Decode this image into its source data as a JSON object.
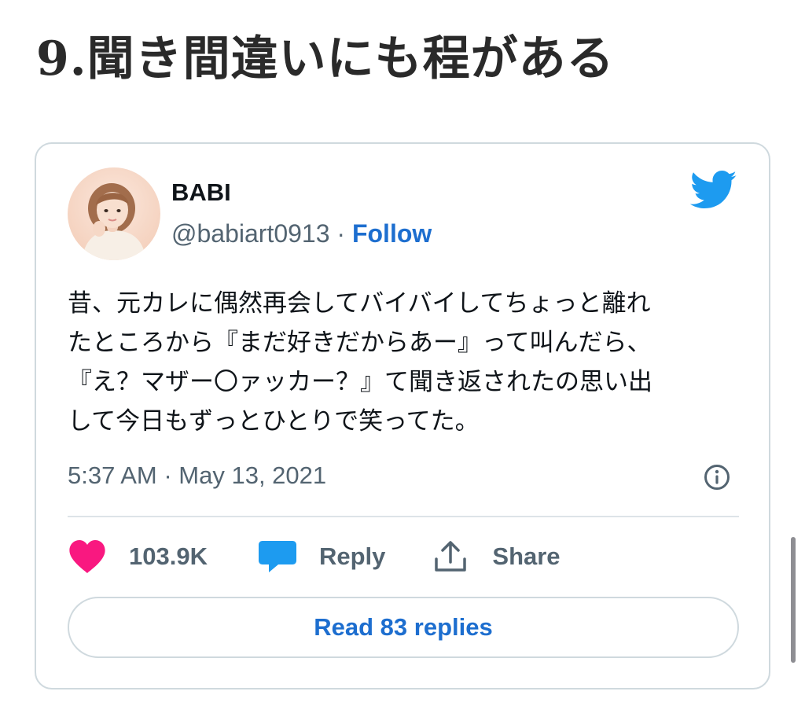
{
  "page": {
    "heading": "9.聞き間違いにも程がある"
  },
  "tweet": {
    "author_name": "BABI",
    "handle": "@babiart0913",
    "separator": " · ",
    "follow_label": "Follow",
    "text": "昔、元カレに偶然再会してバイバイしてちょっと離れ\nたところから『まだ好きだからあー』って叫んだら、\n『え？マザー〇ァッカー？』て聞き返されたの思い出\nして今日もずっとひとりで笑ってた。",
    "timestamp": "5:37 AM · May 13, 2021",
    "likes": "103.9K",
    "reply_label": "Reply",
    "share_label": "Share",
    "read_replies_label": "Read 83 replies"
  },
  "icons": {
    "brand": "twitter-bird-icon",
    "info": "info-icon",
    "like": "heart-icon",
    "reply": "speech-bubble-icon",
    "share": "share-upload-icon"
  },
  "colors": {
    "twitter_blue": "#1d9bf0",
    "link_blue": "#1d6ecf",
    "heart_pink": "#f91880",
    "muted_text": "#536471",
    "border": "#cfd9de"
  }
}
